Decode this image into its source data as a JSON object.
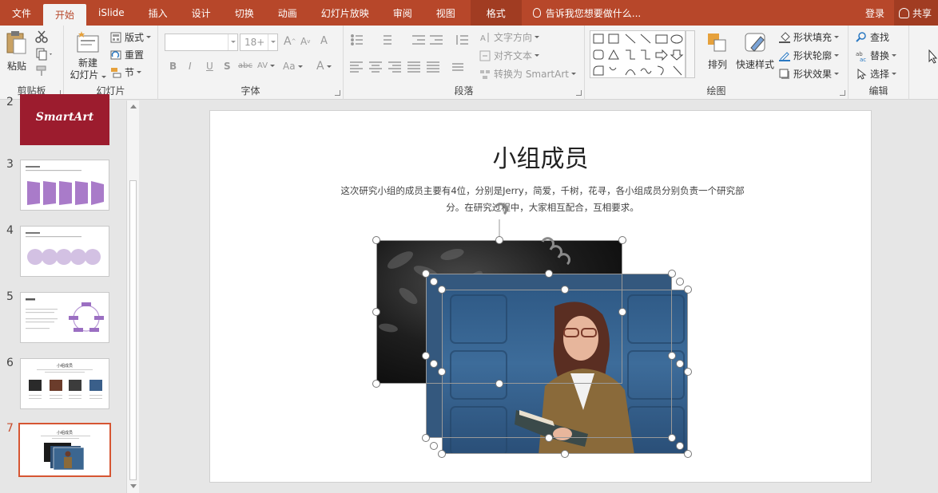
{
  "tabs": [
    "文件",
    "开始",
    "iSlide",
    "插入",
    "设计",
    "切换",
    "动画",
    "幻灯片放映",
    "审阅",
    "视图",
    "格式"
  ],
  "tell_me": "告诉我您想要做什么...",
  "login": "登录",
  "share": "共享",
  "ribbon": {
    "clipboard": {
      "label": "剪贴板",
      "paste": "粘贴"
    },
    "slides": {
      "label": "幻灯片",
      "new_slide_1": "新建",
      "new_slide_2": "幻灯片",
      "layout": "版式",
      "reset": "重置",
      "section": "节"
    },
    "font": {
      "label": "字体",
      "font_size": "18+",
      "bold": "B",
      "italic": "I",
      "underline": "U",
      "shadow": "S",
      "strike": "abc",
      "spacing": "AV",
      "case": "Aa",
      "color_a": "A",
      "grow": "A",
      "shrink": "A",
      "clear": "A"
    },
    "paragraph": {
      "label": "段落",
      "text_direction": "文字方向",
      "align_text": "对齐文本",
      "convert_smartart": "转换为 SmartArt"
    },
    "drawing": {
      "label": "绘图",
      "arrange": "排列",
      "quick_styles": "快速样式",
      "shape_fill": "形状填充",
      "shape_outline": "形状轮廓",
      "shape_effects": "形状效果"
    },
    "editing": {
      "label": "编辑",
      "find": "查找",
      "replace": "替换",
      "select": "选择"
    }
  },
  "thumbnails": [
    {
      "num": "2",
      "title": "SmartArt"
    },
    {
      "num": "3",
      "title": ""
    },
    {
      "num": "4",
      "title": ""
    },
    {
      "num": "5",
      "title": ""
    },
    {
      "num": "6",
      "title": "小组成员"
    },
    {
      "num": "7",
      "title": "小组成员"
    }
  ],
  "slide": {
    "title": "小组成员",
    "body": "这次研究小组的成员主要有4位，分别是Jerry，简爱，千树，花寻，各小组成员分别负责一个研究部分。在研究过程中，大家相互配合，互相要求。"
  },
  "colors": {
    "accent": "#b7472a",
    "selected_thumb": "#d65532",
    "smartart_bg": "#9c1c2e",
    "purple": "#a97bc9"
  }
}
